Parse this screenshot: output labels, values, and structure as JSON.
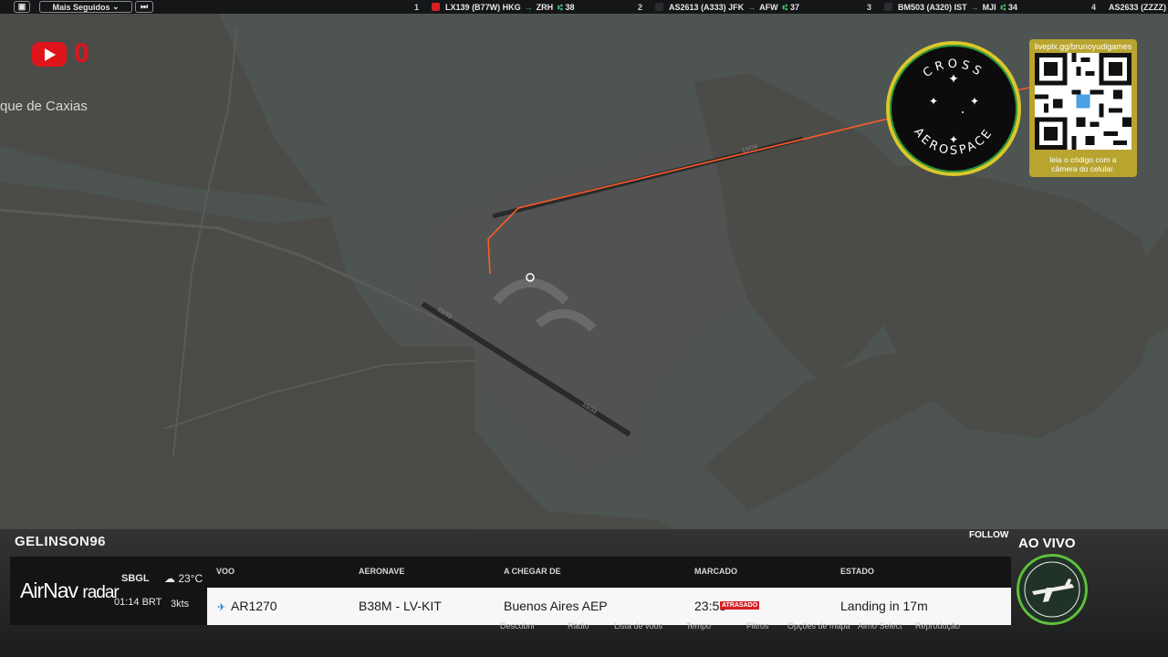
{
  "topbar": {
    "menu_label": "Mais Seguidos",
    "flights": [
      {
        "rank": "1",
        "callsign": "LX139",
        "aircraft": "(B77W)",
        "origin": "HKG",
        "destination": "ZRH",
        "seats": "38",
        "flag_color": "#d71f26"
      },
      {
        "rank": "2",
        "callsign": "AS2613",
        "aircraft": "(A333)",
        "origin": "JFK",
        "destination": "AFW",
        "seats": "37",
        "flag_color": "#141618"
      },
      {
        "rank": "3",
        "callsign": "BM503",
        "aircraft": "(A320)",
        "origin": "IST",
        "destination": "MJI",
        "seats": "34",
        "flag_color": "#141618"
      },
      {
        "rank": "4",
        "callsign": "AS2633",
        "aircraft": "(ZZZZ)",
        "origin": "",
        "destination": "",
        "seats": "",
        "flag_color": "#141618"
      }
    ]
  },
  "youtube": {
    "count": "0"
  },
  "map": {
    "place_label": "que de Caxias",
    "runway_labels": [
      "10/28",
      "15/33",
      "15/33"
    ],
    "colors": {
      "water": "#4c5351",
      "land": "#4a4b47",
      "route": "#ff5a28"
    }
  },
  "badge": {
    "top_text": "CROSS",
    "bottom_text": "AEROSPACE"
  },
  "qr": {
    "url": "liveplx.gg/brunoyudigames",
    "caption_line1": "leia o código com a",
    "caption_line2": "câmera do celular."
  },
  "stream": {
    "username": "GELINSON96",
    "follow_label": "FOLLOW",
    "live_label": "AO VIVO"
  },
  "airnav": {
    "brand": "AirNav",
    "brand_sub": "radar",
    "airport": "SBGL",
    "local_time": "01:14 BRT",
    "temperature": "23°C",
    "wind": "3kts",
    "headers": {
      "flight": "VOO",
      "aircraft": "AERONAVE",
      "from": "A CHEGAR DE",
      "scheduled": "MARCADO",
      "status": "ESTADO"
    },
    "row": {
      "flight": "AR1270",
      "aircraft": "B38M - LV-KIT",
      "from": "Buenos Aires AEP",
      "scheduled": "23:55",
      "delay_badge": "ATRASADO",
      "status": "Landing in 17m"
    },
    "footer_items": [
      "Descobrir",
      "Rádio",
      "Lista de voos",
      "Tempo",
      "Filtros",
      "Opções de mapa",
      "Airno Select",
      "Reprodução"
    ]
  }
}
